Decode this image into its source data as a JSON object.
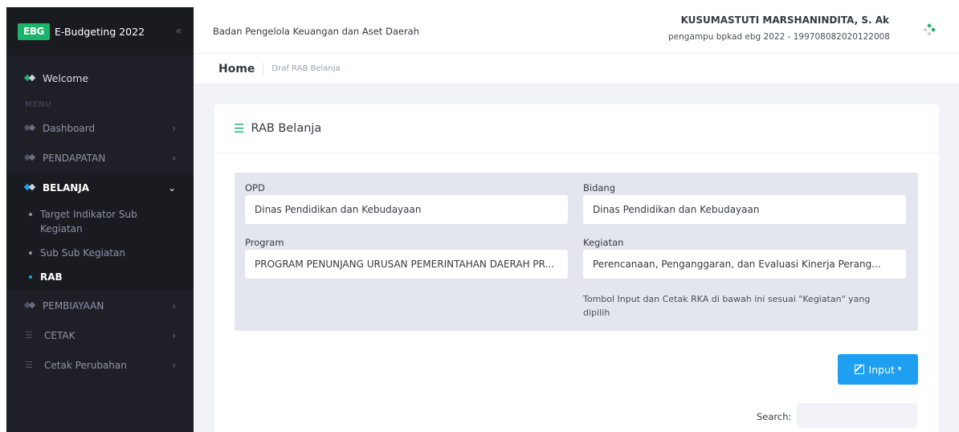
{
  "brand": {
    "logo": "EBG",
    "title": "E-Budgeting 2022",
    "collapse_icon": "double-chevron-left-icon"
  },
  "sidebar": {
    "welcome": "Welcome",
    "menu_header": "MENU",
    "items": [
      {
        "label": "Dashboard"
      },
      {
        "label": "PENDAPATAN"
      },
      {
        "label": "BELANJA"
      },
      {
        "label": "PEMBIAYAAN"
      },
      {
        "label": "CETAK"
      },
      {
        "label": "Cetak Perubahan"
      }
    ],
    "belanja_sub": [
      {
        "label": "Target Indikator Sub Kegiatan"
      },
      {
        "label": "Sub Sub Kegiatan"
      },
      {
        "label": "RAB"
      }
    ]
  },
  "header": {
    "org_name": "Badan Pengelola Keuangan dan Aset Daerah",
    "user_name": "KUSUMASTUTI MARSHANINDITA, S. Ak",
    "user_role": "pengampu bpkad ebg 2022 - 199708082020122008"
  },
  "breadcrumb": {
    "home": "Home",
    "current": "Draf RAB Belanja"
  },
  "card": {
    "title": "RAB Belanja",
    "fields": {
      "opd": {
        "label": "OPD",
        "value": "Dinas Pendidikan dan Kebudayaan"
      },
      "bidang": {
        "label": "Bidang",
        "value": "Dinas Pendidikan dan Kebudayaan"
      },
      "program": {
        "label": "Program",
        "value": "PROGRAM PENUNJANG URUSAN PEMERINTAHAN DAERAH PR..."
      },
      "kegiatan": {
        "label": "Kegiatan",
        "value": "Perencanaan, Penganggaran, dan Evaluasi Kinerja Perang..."
      }
    },
    "note": "Tombol Input dan Cetak RKA di bawah ini sesuai \"Kegiatan\" yang dipilih",
    "input_button": "Input",
    "search_label": "Search:",
    "search_value": ""
  },
  "colors": {
    "accent_green": "#1cb46a",
    "accent_blue": "#1e9ff2",
    "sidebar_bg": "#1f2027"
  }
}
